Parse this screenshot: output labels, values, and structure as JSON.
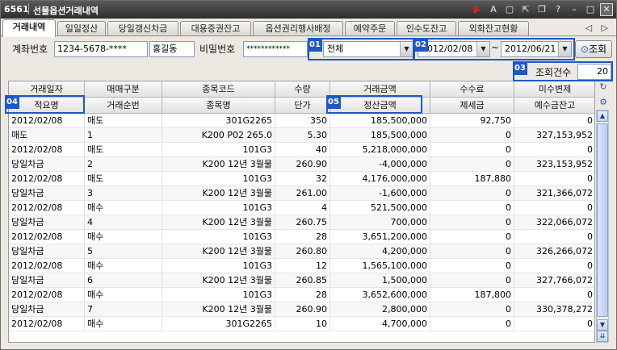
{
  "window": {
    "code": "6561",
    "title": "선물옵션거래내역",
    "icons": [
      "play-icon",
      "font-icon",
      "window-icon",
      "popout-icon",
      "copy-icon",
      "help-icon",
      "minimize-icon",
      "maximize-icon",
      "close-icon"
    ]
  },
  "tabs": [
    {
      "label": "거래내역",
      "active": true
    },
    {
      "label": "일일정산",
      "active": false
    },
    {
      "label": "당일갱신차금",
      "active": false
    },
    {
      "label": "대용증권잔고",
      "active": false
    },
    {
      "label": "옵션권리행사배정",
      "active": false
    },
    {
      "label": "예약주문",
      "active": false
    },
    {
      "label": "인수도잔고",
      "active": false
    },
    {
      "label": "외화잔고현황",
      "active": false
    }
  ],
  "tab_nav": "◁ ▷",
  "search": {
    "account_label": "계좌번호",
    "account_value": "1234-5678-****",
    "account_name": "홍길동",
    "password_label": "비밀번호",
    "password_value": "************",
    "type_select": "전체",
    "date_from": "2012/02/08",
    "date_sep": "~",
    "date_to": "2012/06/21",
    "query_button": "조회",
    "count_label": "조회건수",
    "count_value": "20"
  },
  "badges": [
    "01",
    "02",
    "03",
    "04",
    "05"
  ],
  "columns_row1": [
    "거래일자",
    "매매구분",
    "종목코드",
    "수량",
    "거래금액",
    "수수료",
    "미수변제"
  ],
  "columns_row2": [
    "적요명",
    "거래순번",
    "종목명",
    "단가",
    "정산금액",
    "제세금",
    "예수금잔고"
  ],
  "rows": [
    [
      "2012/02/08",
      "매도",
      "301G2265",
      "350",
      "185,500,000",
      "92,750",
      "0"
    ],
    [
      "매도",
      "1",
      "K200 P02 265.0",
      "5.30",
      "185,500,000",
      "0",
      "327,153,952"
    ],
    [
      "2012/02/08",
      "매도",
      "101G3",
      "40",
      "5,218,000,000",
      "0",
      "0"
    ],
    [
      "당일차금",
      "2",
      "K200 12년  3월물",
      "260.90",
      "-4,000,000",
      "0",
      "323,153,952"
    ],
    [
      "2012/02/08",
      "매도",
      "101G3",
      "32",
      "4,176,000,000",
      "187,880",
      "0"
    ],
    [
      "당일차금",
      "3",
      "K200 12년  3월물",
      "261.00",
      "-1,600,000",
      "0",
      "321,366,072"
    ],
    [
      "2012/02/08",
      "매수",
      "101G3",
      "4",
      "521,500,000",
      "0",
      "0"
    ],
    [
      "당일차금",
      "4",
      "K200 12년  3월물",
      "260.75",
      "700,000",
      "0",
      "322,066,072"
    ],
    [
      "2012/02/08",
      "매수",
      "101G3",
      "28",
      "3,651,200,000",
      "0",
      "0"
    ],
    [
      "당일차금",
      "5",
      "K200 12년  3월물",
      "260.80",
      "4,200,000",
      "0",
      "326,266,072"
    ],
    [
      "2012/02/08",
      "매수",
      "101G3",
      "12",
      "1,565,100,000",
      "0",
      "0"
    ],
    [
      "당일차금",
      "6",
      "K200 12년  3월물",
      "260.85",
      "1,500,000",
      "0",
      "327,766,072"
    ],
    [
      "2012/02/08",
      "매수",
      "101G3",
      "28",
      "3,652,600,000",
      "187,800",
      "0"
    ],
    [
      "당일차금",
      "7",
      "K200 12년  3월물",
      "260.90",
      "2,800,000",
      "0",
      "330,378,272"
    ],
    [
      "2012/02/08",
      "매수",
      "301G2265",
      "10",
      "4,700,000",
      "0",
      "0"
    ]
  ]
}
